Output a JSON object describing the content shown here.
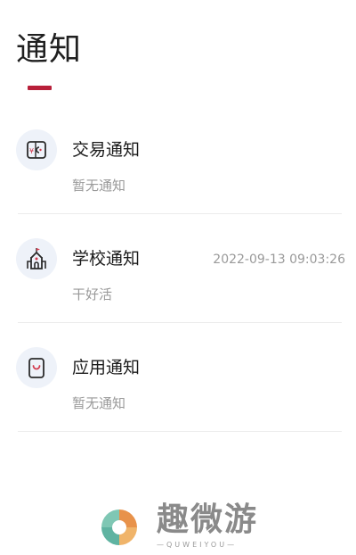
{
  "page": {
    "title": "通知"
  },
  "colors": {
    "accent": "#b8203a",
    "icon_bg": "#eef2f9",
    "icon_stroke": "#2b2b2b",
    "icon_accent": "#d23a4e"
  },
  "notifications": [
    {
      "icon": "transaction-icon",
      "title": "交易通知",
      "subtitle": "暂无通知",
      "time": ""
    },
    {
      "icon": "school-icon",
      "title": "学校通知",
      "subtitle": "干好活",
      "time": "2022-09-13 09:03:26"
    },
    {
      "icon": "app-icon",
      "title": "应用通知",
      "subtitle": "暂无通知",
      "time": ""
    }
  ],
  "watermark": {
    "text": "趣微游",
    "subtext": "—QUWEIYOU—"
  }
}
